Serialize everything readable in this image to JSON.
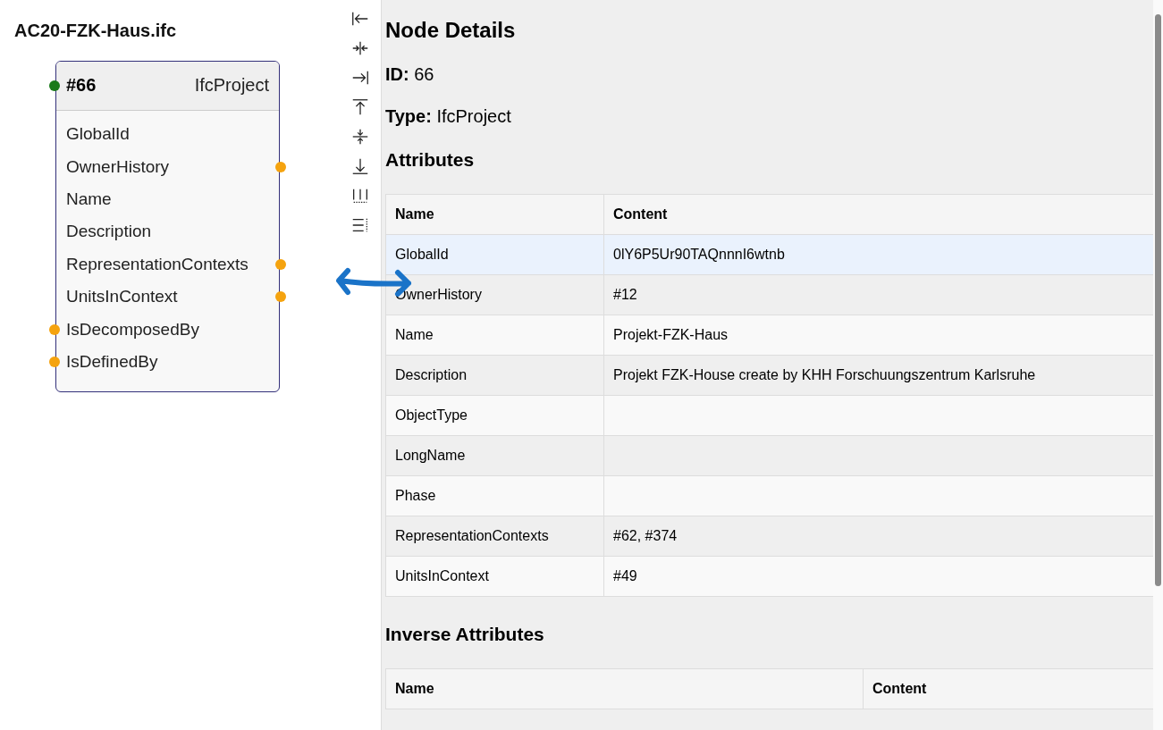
{
  "file_title": "AC20-FZK-Haus.ifc",
  "node": {
    "id": "#66",
    "type": "IfcProject",
    "attributes": [
      {
        "name": "GlobalId",
        "input_port": false,
        "output_port": false
      },
      {
        "name": "OwnerHistory",
        "input_port": false,
        "output_port": true
      },
      {
        "name": "Name",
        "input_port": false,
        "output_port": false
      },
      {
        "name": "Description",
        "input_port": false,
        "output_port": false
      },
      {
        "name": "RepresentationContexts",
        "input_port": false,
        "output_port": true
      },
      {
        "name": "UnitsInContext",
        "input_port": false,
        "output_port": true
      },
      {
        "name": "IsDecomposedBy",
        "input_port": true,
        "output_port": false
      },
      {
        "name": "IsDefinedBy",
        "input_port": true,
        "output_port": false
      }
    ]
  },
  "details": {
    "title": "Node Details",
    "id_label": "ID:",
    "id_value": "66",
    "type_label": "Type:",
    "type_value": "IfcProject",
    "attributes_title": "Attributes",
    "attributes_columns": [
      "Name",
      "Content"
    ],
    "attributes_rows": [
      {
        "name": "GlobalId",
        "content": "0lY6P5Ur90TAQnnnI6wtnb",
        "selected": true
      },
      {
        "name": "OwnerHistory",
        "content": "#12",
        "selected": false
      },
      {
        "name": "Name",
        "content": "Projekt-FZK-Haus",
        "selected": false
      },
      {
        "name": "Description",
        "content": "Projekt FZK-House create by KHH Forschuungszentrum Karlsruhe",
        "selected": false
      },
      {
        "name": "ObjectType",
        "selected": false
      },
      {
        "name": "LongName",
        "selected": false
      },
      {
        "name": "Phase",
        "selected": false
      },
      {
        "name": "RepresentationContexts",
        "content": "#62, #374",
        "selected": false
      },
      {
        "name": "UnitsInContext",
        "content": "#49",
        "selected": false
      }
    ],
    "inverse_title": "Inverse Attributes",
    "inverse_columns": [
      "Name",
      "Content"
    ]
  }
}
